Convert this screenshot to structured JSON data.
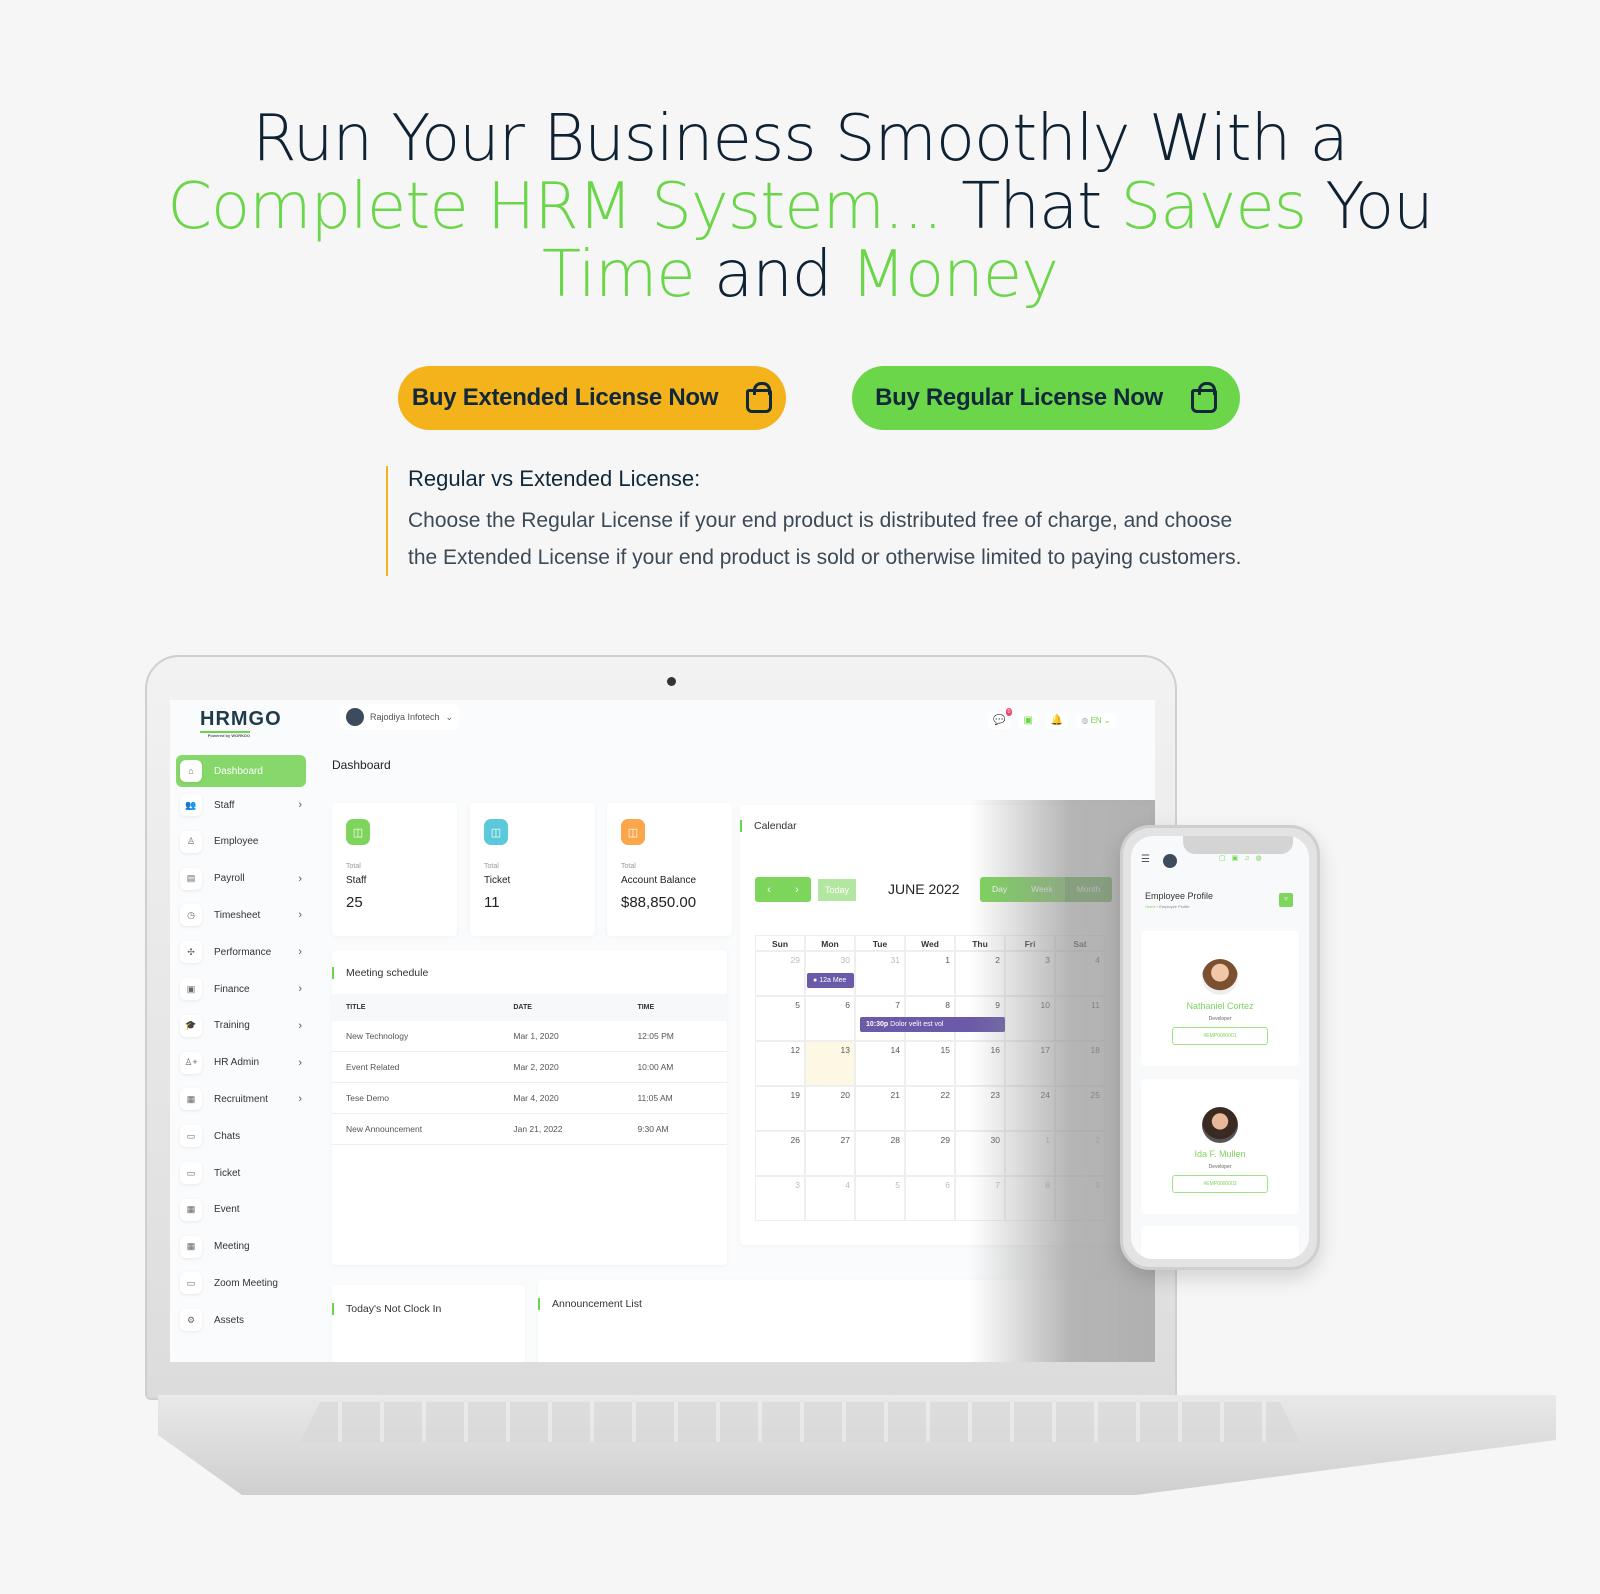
{
  "hero": {
    "line1": "Run Your Business Smoothly With a",
    "l2a": "Complete HRM System...",
    "l2b": " That ",
    "l2c": "Saves",
    "l2d": " You",
    "l3a": "Time",
    "l3b": " and ",
    "l3c": "Money"
  },
  "buttons": {
    "extended": "Buy Extended License Now",
    "regular": "Buy Regular License Now",
    "extended_color": "#f4b21b",
    "regular_color": "#6cd64a"
  },
  "note": {
    "title": "Regular vs Extended License:",
    "body": "Choose the Regular License if your end product is distributed free of charge, and choose the Extended License if your end product is sold or otherwise limited to paying customers."
  },
  "app": {
    "logo": "HRMGO",
    "logo_sub": "Powered by WORKDO",
    "user": "Rajodiya Infotech",
    "badge": "0",
    "lang": "EN",
    "page_title": "Dashboard",
    "sidebar": [
      {
        "label": "Dashboard",
        "icon": "home-icon",
        "active": true
      },
      {
        "label": "Staff",
        "icon": "users-icon",
        "chev": true
      },
      {
        "label": "Employee",
        "icon": "user-icon"
      },
      {
        "label": "Payroll",
        "icon": "receipt-icon",
        "chev": true
      },
      {
        "label": "Timesheet",
        "icon": "clock-icon",
        "chev": true
      },
      {
        "label": "Performance",
        "icon": "chart-icon",
        "chev": true
      },
      {
        "label": "Finance",
        "icon": "wallet-icon",
        "chev": true
      },
      {
        "label": "Training",
        "icon": "graduation-icon",
        "chev": true
      },
      {
        "label": "HR Admin",
        "icon": "user-plus-icon",
        "chev": true
      },
      {
        "label": "Recruitment",
        "icon": "clipboard-icon",
        "chev": true
      },
      {
        "label": "Chats",
        "icon": "chat-icon"
      },
      {
        "label": "Ticket",
        "icon": "ticket-icon"
      },
      {
        "label": "Event",
        "icon": "calendar-icon"
      },
      {
        "label": "Meeting",
        "icon": "calendar-event-icon"
      },
      {
        "label": "Zoom Meeting",
        "icon": "video-icon"
      },
      {
        "label": "Assets",
        "icon": "gear-icon"
      }
    ],
    "stats": [
      {
        "pre": "Total",
        "label": "Staff",
        "value": "25",
        "color": "#7dd55c",
        "icon": "users-icon"
      },
      {
        "pre": "Total",
        "label": "Ticket",
        "value": "11",
        "color": "#5bc9d9",
        "icon": "ticket-icon"
      },
      {
        "pre": "Total",
        "label": "Account Balance",
        "value": "$88,850.00",
        "color": "#fba64b",
        "icon": "wallet-icon"
      }
    ],
    "meeting": {
      "title": "Meeting schedule",
      "columns": [
        "TITLE",
        "DATE",
        "TIME"
      ],
      "rows": [
        [
          "New Technology",
          "Mar 1, 2020",
          "12:05 PM"
        ],
        [
          "Event Related",
          "Mar 2, 2020",
          "10:00 AM"
        ],
        [
          "Tese Demo",
          "Mar 4, 2020",
          "11:05 AM"
        ],
        [
          "New Announcement",
          "Jan 21, 2022",
          "9:30 AM"
        ]
      ]
    },
    "calendar": {
      "title": "Calendar",
      "today": "Today",
      "month": "JUNE 2022",
      "views": [
        "Day",
        "Week",
        "Month"
      ],
      "active_view": "Month",
      "days": [
        "Sun",
        "Mon",
        "Tue",
        "Wed",
        "Thu",
        "Fri",
        "Sat"
      ],
      "weeks": [
        [
          "29",
          "30",
          "31",
          "1",
          "2",
          "3",
          "4"
        ],
        [
          "5",
          "6",
          "7",
          "8",
          "9",
          "10",
          "11"
        ],
        [
          "12",
          "13",
          "14",
          "15",
          "16",
          "17",
          "18"
        ],
        [
          "19",
          "20",
          "21",
          "22",
          "23",
          "24",
          "25"
        ],
        [
          "26",
          "27",
          "28",
          "29",
          "30",
          "1",
          "2"
        ],
        [
          "3",
          "4",
          "5",
          "6",
          "7",
          "8",
          "9"
        ]
      ],
      "events": [
        {
          "time": "12a",
          "label": "Mee"
        },
        {
          "time": "10:30p",
          "label": "Dolor velit est vol"
        }
      ],
      "event_color": "#6a5aa8"
    },
    "bottom": {
      "clock": "Today's Not Clock In",
      "announce": "Announcement List"
    }
  },
  "phone": {
    "title": "Employee Profile",
    "crumb_home": "Home",
    "crumb_page": "Employee Profile",
    "employees": [
      {
        "name": "Nathaniel Cortez",
        "role": "Developer",
        "id": "#EMP0000001"
      },
      {
        "name": "Ida F. Mullen",
        "role": "Developer",
        "id": "#EMP0000003"
      }
    ]
  }
}
